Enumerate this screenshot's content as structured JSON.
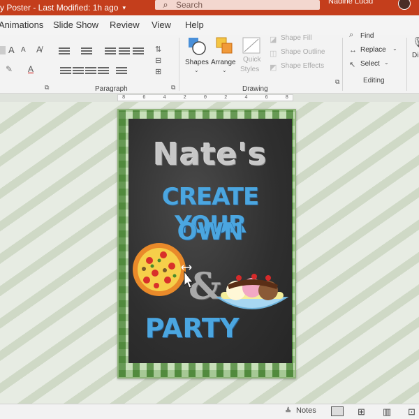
{
  "titlebar": {
    "doc_title": "y Poster  -  Last Modified: 1h ago",
    "caret": "▾",
    "search_placeholder": "Search",
    "user_name": "Nadine Lucid"
  },
  "tabs": [
    "Animations",
    "Slide Show",
    "Review",
    "View",
    "Help"
  ],
  "ribbon": {
    "groups": {
      "paragraph": "Paragraph",
      "drawing": "Drawing",
      "editing": "Editing"
    },
    "drawing": {
      "shapes": "Shapes",
      "arrange": "Arrange",
      "quick_styles_1": "Quick",
      "quick_styles_2": "Styles",
      "shape_fill": "Shape Fill",
      "shape_outline": "Shape Outline",
      "shape_effects": "Shape Effects"
    },
    "editing": {
      "find": "Find",
      "replace": "Replace",
      "select": "Select"
    },
    "font_controls": {
      "grow": "A",
      "shrink": "A"
    },
    "partial_right": "Di"
  },
  "ruler": [
    "8",
    "6",
    "4",
    "2",
    "0",
    "2",
    "4",
    "6",
    "8"
  ],
  "slide": {
    "name": "Nate's",
    "line1": "CREATE YOUR",
    "line2": "OWN",
    "amp": "&",
    "line3": "PARTY"
  },
  "statusbar": {
    "notes": "Notes"
  },
  "colors": {
    "titlebar": "#c43e1c",
    "chalkboard": "#2f2f2f",
    "chalk_blue": "#4ba6e0",
    "gingham_green": "#4f8a3a"
  }
}
